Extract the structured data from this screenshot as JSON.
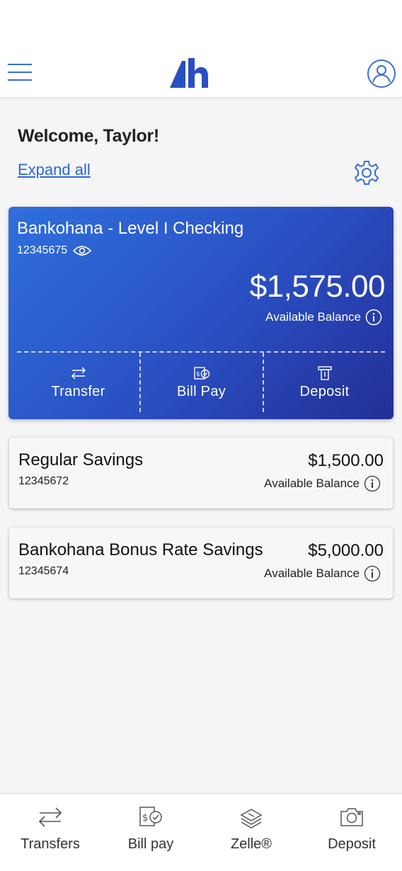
{
  "header": {
    "menu_icon": "hamburger-menu-icon",
    "logo_icon": "bank-logo-icon",
    "profile_icon": "user-profile-icon"
  },
  "welcome": {
    "greeting": "Welcome, Taylor!",
    "expand_all": "Expand all",
    "settings_icon": "gear-icon"
  },
  "checking": {
    "name": "Bankohana - Level I Checking",
    "number": "12345675",
    "balance": "$1,575.00",
    "balance_label": "Available Balance",
    "actions": [
      {
        "label": "Transfer",
        "icon": "transfer-arrows-icon"
      },
      {
        "label": "Bill Pay",
        "icon": "bill-pay-icon"
      },
      {
        "label": "Deposit",
        "icon": "check-deposit-icon"
      }
    ]
  },
  "accounts": [
    {
      "name": "Regular Savings",
      "number": "12345672",
      "balance": "$1,500.00",
      "balance_label": "Available Balance"
    },
    {
      "name": "Bankohana Bonus Rate Savings",
      "number": "12345674",
      "balance": "$5,000.00",
      "balance_label": "Available Balance"
    }
  ],
  "bottom_nav": [
    {
      "label": "Transfers",
      "icon": "transfer-arrows-icon"
    },
    {
      "label": "Bill pay",
      "icon": "bill-pay-icon"
    },
    {
      "label": "Zelle®",
      "icon": "money-stack-icon"
    },
    {
      "label": "Deposit",
      "icon": "camera-icon"
    }
  ],
  "colors": {
    "brand_blue": "#2a4fc2",
    "link_blue": "#2b66d9"
  }
}
